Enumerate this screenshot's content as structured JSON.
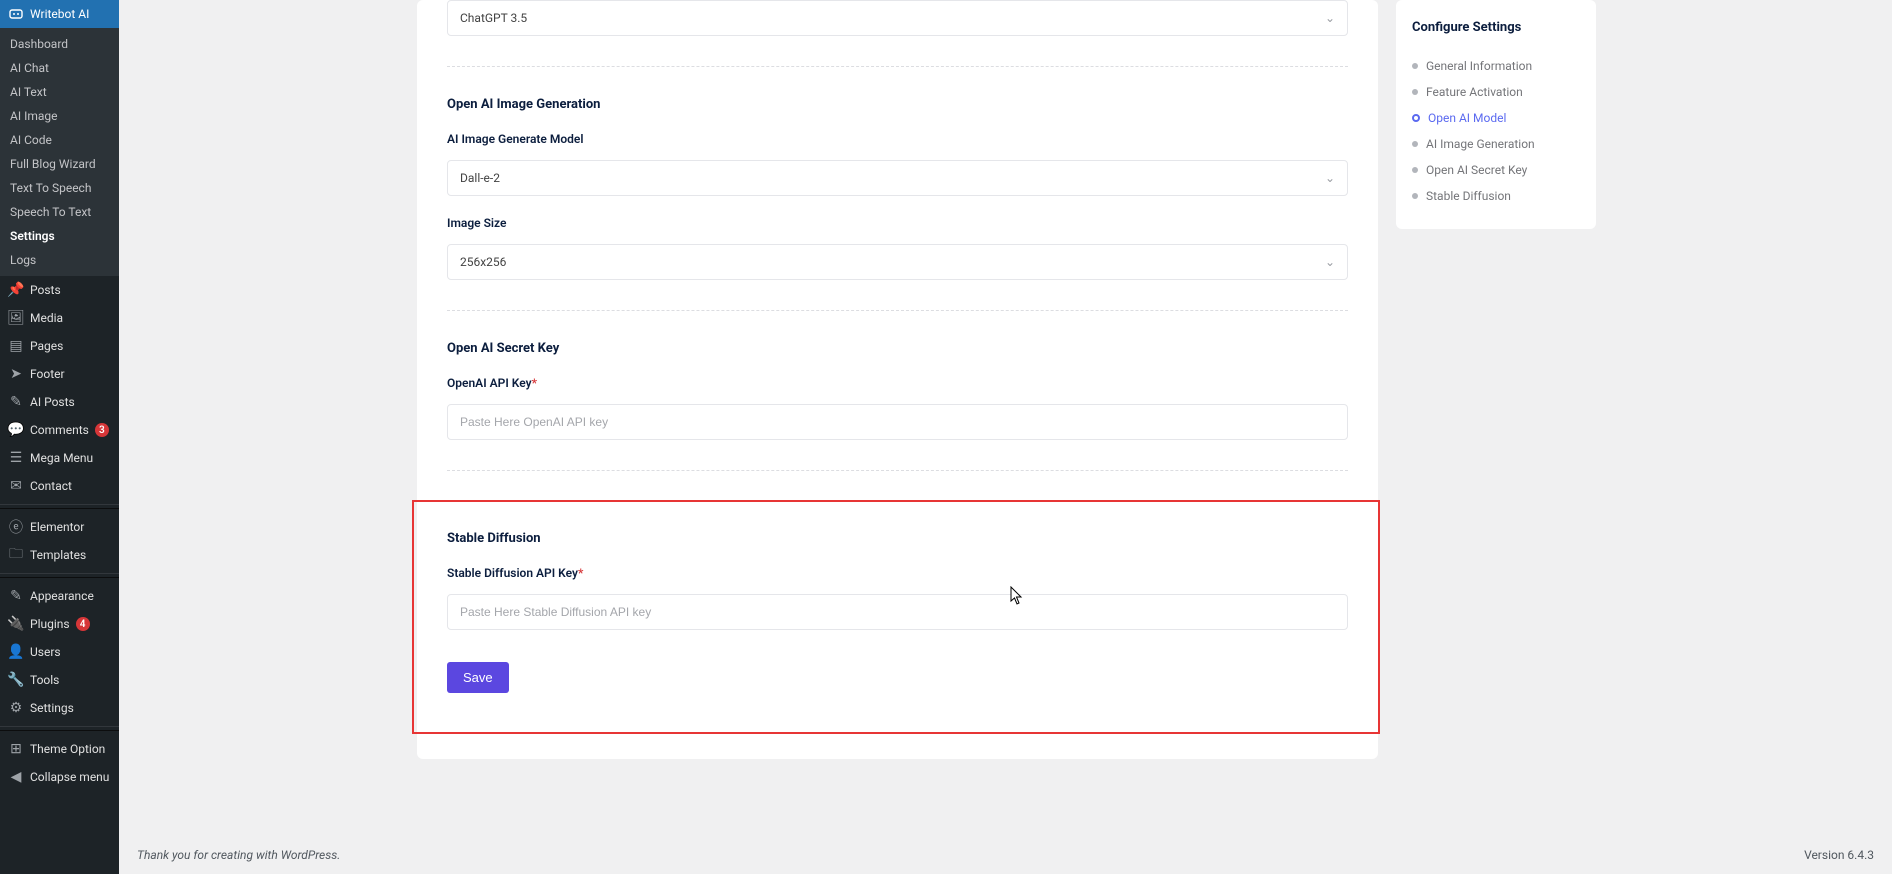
{
  "sidebar": {
    "activeParent": {
      "label": "Writebot AI"
    },
    "sub": [
      {
        "label": "Dashboard"
      },
      {
        "label": "AI Chat"
      },
      {
        "label": "AI Text"
      },
      {
        "label": "AI Image"
      },
      {
        "label": "AI Code"
      },
      {
        "label": "Full Blog Wizard"
      },
      {
        "label": "Text To Speech"
      },
      {
        "label": "Speech To Text"
      },
      {
        "label": "Settings"
      },
      {
        "label": "Logs"
      }
    ],
    "items": [
      {
        "icon": "pin-icon",
        "label": "Posts"
      },
      {
        "icon": "media-icon",
        "label": "Media"
      },
      {
        "icon": "page-icon",
        "label": "Pages"
      },
      {
        "icon": "footer-icon",
        "label": "Footer"
      },
      {
        "icon": "aiposts-icon",
        "label": "AI Posts"
      },
      {
        "icon": "comments-icon",
        "label": "Comments",
        "badge": "3",
        "badgeClass": "red"
      },
      {
        "icon": "megamenu-icon",
        "label": "Mega Menu"
      },
      {
        "icon": "contact-icon",
        "label": "Contact"
      },
      {
        "divider": true
      },
      {
        "icon": "elementor-icon",
        "label": "Elementor"
      },
      {
        "icon": "templates-icon",
        "label": "Templates"
      },
      {
        "divider": true
      },
      {
        "icon": "appearance-icon",
        "label": "Appearance"
      },
      {
        "icon": "plugins-icon",
        "label": "Plugins",
        "badge": "4",
        "badgeClass": "orange"
      },
      {
        "icon": "users-icon",
        "label": "Users"
      },
      {
        "icon": "tools-icon",
        "label": "Tools"
      },
      {
        "icon": "settings-icon",
        "label": "Settings"
      },
      {
        "divider": true
      },
      {
        "icon": "themeoption-icon",
        "label": "Theme Option"
      },
      {
        "icon": "collapse-icon",
        "label": "Collapse menu"
      }
    ]
  },
  "form": {
    "chatModel": {
      "value": "ChatGPT 3.5"
    },
    "imageGen": {
      "heading": "Open AI Image Generation",
      "modelLabel": "AI Image Generate Model",
      "modelValue": "Dall-e-2",
      "sizeLabel": "Image Size",
      "sizeValue": "256x256"
    },
    "secret": {
      "heading": "Open AI Secret Key",
      "label": "OpenAI API Key",
      "placeholder": "Paste Here OpenAI API key"
    },
    "stable": {
      "heading": "Stable Diffusion",
      "label": "Stable Diffusion API Key",
      "placeholder": "Paste Here Stable Diffusion API key"
    },
    "saveLabel": "Save"
  },
  "toc": {
    "heading": "Configure Settings",
    "items": [
      {
        "label": "General Information",
        "active": false
      },
      {
        "label": "Feature Activation",
        "active": false
      },
      {
        "label": "Open AI Model",
        "active": true
      },
      {
        "label": "AI Image Generation",
        "active": false
      },
      {
        "label": "Open AI Secret Key",
        "active": false
      },
      {
        "label": "Stable Diffusion",
        "active": false
      }
    ]
  },
  "footer": {
    "thanks": "Thank you for creating with WordPress.",
    "version": "Version 6.4.3"
  },
  "icons": {
    "pin-icon": "📌",
    "media-icon": "🖼",
    "page-icon": "▤",
    "footer-icon": "➤",
    "aiposts-icon": "✎",
    "comments-icon": "💬",
    "megamenu-icon": "☰",
    "contact-icon": "✉",
    "elementor-icon": "ⓔ",
    "templates-icon": "🗀",
    "appearance-icon": "✎",
    "plugins-icon": "🔌",
    "users-icon": "👤",
    "tools-icon": "🔧",
    "settings-icon": "⚙",
    "themeoption-icon": "⊞",
    "collapse-icon": "◀",
    "writebot-icon": "⬚"
  }
}
